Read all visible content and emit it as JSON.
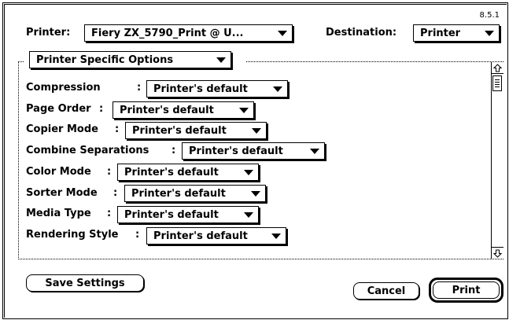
{
  "version": "8.5.1",
  "printer": {
    "label": "Printer:",
    "value": "Fiery ZX_5790_Print @ U..."
  },
  "destination": {
    "label": "Destination:",
    "value": "Printer"
  },
  "options_menu": {
    "value": "Printer Specific Options"
  },
  "options": [
    {
      "label": "Compression",
      "separator": ":",
      "value": "Printer's default"
    },
    {
      "label": "Page Order",
      "separator": ":",
      "value": "Printer's default"
    },
    {
      "label": "Copier Mode",
      "separator": ":",
      "value": "Printer's default"
    },
    {
      "label": "Combine Separations",
      "separator": ":",
      "value": "Printer's default"
    },
    {
      "label": "Color Mode",
      "separator": ":",
      "value": "Printer's default"
    },
    {
      "label": "Sorter Mode",
      "separator": ":",
      "value": "Printer's default"
    },
    {
      "label": "Media Type",
      "separator": ":",
      "value": "Printer's default"
    },
    {
      "label": "Rendering Style",
      "separator": ":",
      "value": "Printer's default"
    }
  ],
  "buttons": {
    "save_settings": "Save Settings",
    "cancel": "Cancel",
    "print": "Print"
  },
  "icons": {
    "scroll_up": "arrow-up-icon",
    "scroll_down": "arrow-down-icon",
    "popup_arrow": "triangle-down-icon"
  }
}
